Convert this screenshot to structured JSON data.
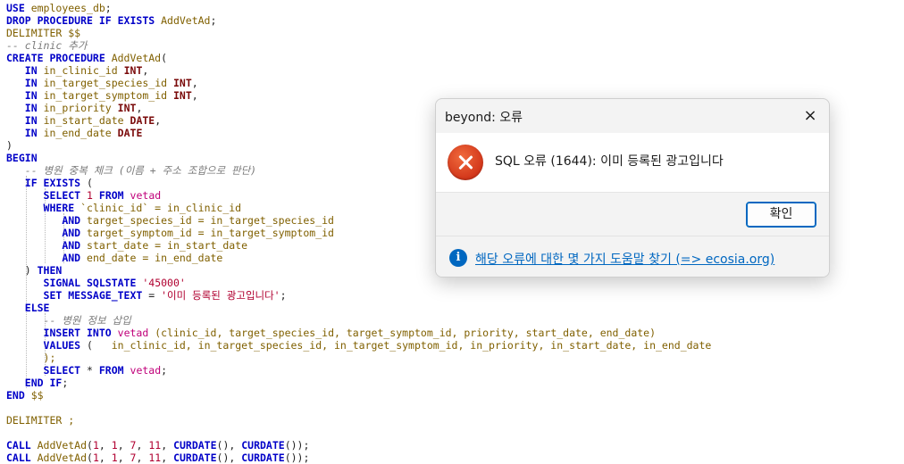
{
  "editor": {
    "lines": [
      [
        [
          "kw",
          "USE"
        ],
        [
          "id",
          " employees_db"
        ],
        [
          "op",
          ";"
        ]
      ],
      [
        [
          "kw",
          "DROP PROCEDURE IF EXISTS"
        ],
        [
          "id",
          " AddVetAd"
        ],
        [
          "op",
          ";"
        ]
      ],
      [
        [
          "id",
          "DELIMITER $$"
        ]
      ],
      [
        [
          "cm",
          "-- clinic 추가"
        ]
      ],
      [
        [
          "kw",
          "CREATE PROCEDURE"
        ],
        [
          "id",
          " AddVetAd"
        ],
        [
          "op",
          "("
        ]
      ],
      [
        [
          "op",
          "   "
        ],
        [
          "kw",
          "IN"
        ],
        [
          "id",
          " in_clinic_id"
        ],
        [
          "op",
          " "
        ],
        [
          "ty",
          "INT"
        ],
        [
          "op",
          ","
        ]
      ],
      [
        [
          "op",
          "   "
        ],
        [
          "kw",
          "IN"
        ],
        [
          "id",
          " in_target_species_id"
        ],
        [
          "op",
          " "
        ],
        [
          "ty",
          "INT"
        ],
        [
          "op",
          ","
        ]
      ],
      [
        [
          "op",
          "   "
        ],
        [
          "kw",
          "IN"
        ],
        [
          "id",
          " in_target_symptom_id"
        ],
        [
          "op",
          " "
        ],
        [
          "ty",
          "INT"
        ],
        [
          "op",
          ","
        ]
      ],
      [
        [
          "op",
          "   "
        ],
        [
          "kw",
          "IN"
        ],
        [
          "id",
          " in_priority"
        ],
        [
          "op",
          " "
        ],
        [
          "ty",
          "INT"
        ],
        [
          "op",
          ","
        ]
      ],
      [
        [
          "op",
          "   "
        ],
        [
          "kw",
          "IN"
        ],
        [
          "id",
          " in_start_date"
        ],
        [
          "op",
          " "
        ],
        [
          "ty",
          "DATE"
        ],
        [
          "op",
          ","
        ]
      ],
      [
        [
          "op",
          "   "
        ],
        [
          "kw",
          "IN"
        ],
        [
          "id",
          " in_end_date"
        ],
        [
          "op",
          " "
        ],
        [
          "ty",
          "DATE"
        ]
      ],
      [
        [
          "op",
          ")"
        ]
      ],
      [
        [
          "kw",
          "BEGIN"
        ]
      ],
      [
        [
          "op",
          "   "
        ],
        [
          "cm",
          "-- 병원 중복 체크 (이름 + 주소 조합으로 판단)"
        ]
      ],
      [
        [
          "op",
          "   "
        ],
        [
          "kw",
          "IF EXISTS"
        ],
        [
          "op",
          " ("
        ]
      ],
      [
        [
          "op",
          "      "
        ],
        [
          "kw",
          "SELECT"
        ],
        [
          "op",
          " "
        ],
        [
          "num",
          "1"
        ],
        [
          "op",
          " "
        ],
        [
          "kw",
          "FROM"
        ],
        [
          "op",
          " "
        ],
        [
          "tb",
          "vetad"
        ]
      ],
      [
        [
          "op",
          "      "
        ],
        [
          "kw",
          "WHERE"
        ],
        [
          "id",
          " `clinic_id` = in_clinic_id"
        ]
      ],
      [
        [
          "op",
          "         "
        ],
        [
          "kw",
          "AND"
        ],
        [
          "id",
          " target_species_id = in_target_species_id"
        ]
      ],
      [
        [
          "op",
          "         "
        ],
        [
          "kw",
          "AND"
        ],
        [
          "id",
          " target_symptom_id = in_target_symptom_id"
        ]
      ],
      [
        [
          "op",
          "         "
        ],
        [
          "kw",
          "AND"
        ],
        [
          "id",
          " start_date = in_start_date"
        ]
      ],
      [
        [
          "op",
          "         "
        ],
        [
          "kw",
          "AND"
        ],
        [
          "id",
          " end_date = in_end_date"
        ]
      ],
      [
        [
          "op",
          "   ) "
        ],
        [
          "kw",
          "THEN"
        ]
      ],
      [
        [
          "op",
          "      "
        ],
        [
          "kw",
          "SIGNAL SQLSTATE"
        ],
        [
          "op",
          " "
        ],
        [
          "str",
          "'45000'"
        ]
      ],
      [
        [
          "op",
          "      "
        ],
        [
          "kw",
          "SET MESSAGE_TEXT"
        ],
        [
          "op",
          " = "
        ],
        [
          "str",
          "'이미 등록된 광고입니다'"
        ],
        [
          "op",
          ";"
        ]
      ],
      [
        [
          "op",
          "   "
        ],
        [
          "kw",
          "ELSE"
        ]
      ],
      [
        [
          "op",
          "      "
        ],
        [
          "cm",
          "-- 병원 정보 삽입"
        ]
      ],
      [
        [
          "op",
          "      "
        ],
        [
          "kw",
          "INSERT INTO"
        ],
        [
          "op",
          " "
        ],
        [
          "tb",
          "vetad"
        ],
        [
          "id",
          " (clinic_id, target_species_id, target_symptom_id, priority, start_date, end_date)"
        ]
      ],
      [
        [
          "op",
          "      "
        ],
        [
          "kw",
          "VALUES"
        ],
        [
          "op",
          " (   "
        ],
        [
          "id",
          "in_clinic_id, in_target_species_id, in_target_symptom_id, in_priority, in_start_date, in_end_date"
        ]
      ],
      [
        [
          "op",
          "      "
        ],
        [
          "id",
          ");"
        ]
      ],
      [
        [
          "op",
          "      "
        ],
        [
          "kw",
          "SELECT"
        ],
        [
          "op",
          " * "
        ],
        [
          "kw",
          "FROM"
        ],
        [
          "op",
          " "
        ],
        [
          "tb",
          "vetad"
        ],
        [
          "op",
          ";"
        ]
      ],
      [
        [
          "op",
          "   "
        ],
        [
          "kw",
          "END IF"
        ],
        [
          "op",
          ";"
        ]
      ],
      [
        [
          "kw",
          "END"
        ],
        [
          "id",
          " $$"
        ]
      ],
      [
        [
          "op",
          ""
        ]
      ],
      [
        [
          "id",
          "DELIMITER ;"
        ]
      ],
      [
        [
          "op",
          ""
        ]
      ],
      [
        [
          "kw",
          "CALL"
        ],
        [
          "id",
          " AddVetAd"
        ],
        [
          "op",
          "("
        ],
        [
          "num",
          "1"
        ],
        [
          "op",
          ", "
        ],
        [
          "num",
          "1"
        ],
        [
          "op",
          ", "
        ],
        [
          "num",
          "7"
        ],
        [
          "op",
          ", "
        ],
        [
          "num",
          "11"
        ],
        [
          "op",
          ", "
        ],
        [
          "kw",
          "CURDATE"
        ],
        [
          "op",
          "(), "
        ],
        [
          "kw",
          "CURDATE"
        ],
        [
          "op",
          "());"
        ]
      ],
      [
        [
          "kw",
          "CALL"
        ],
        [
          "id",
          " AddVetAd"
        ],
        [
          "op",
          "("
        ],
        [
          "num",
          "1"
        ],
        [
          "op",
          ", "
        ],
        [
          "num",
          "1"
        ],
        [
          "op",
          ", "
        ],
        [
          "num",
          "7"
        ],
        [
          "op",
          ", "
        ],
        [
          "num",
          "11"
        ],
        [
          "op",
          ", "
        ],
        [
          "kw",
          "CURDATE"
        ],
        [
          "op",
          "(), "
        ],
        [
          "kw",
          "CURDATE"
        ],
        [
          "op",
          "());"
        ]
      ]
    ]
  },
  "dialog": {
    "title": "beyond: 오류",
    "close_icon": "×",
    "message": "SQL 오류 (1644): 이미 등록된 광고입니다",
    "ok_label": "확인",
    "info_icon": "i",
    "help_link": "해당 오류에 대한 몇 가지 도움말 찾기 (=> ecosia.org)",
    "accent_color": "#0067c0",
    "error_color": "#d2361a"
  }
}
